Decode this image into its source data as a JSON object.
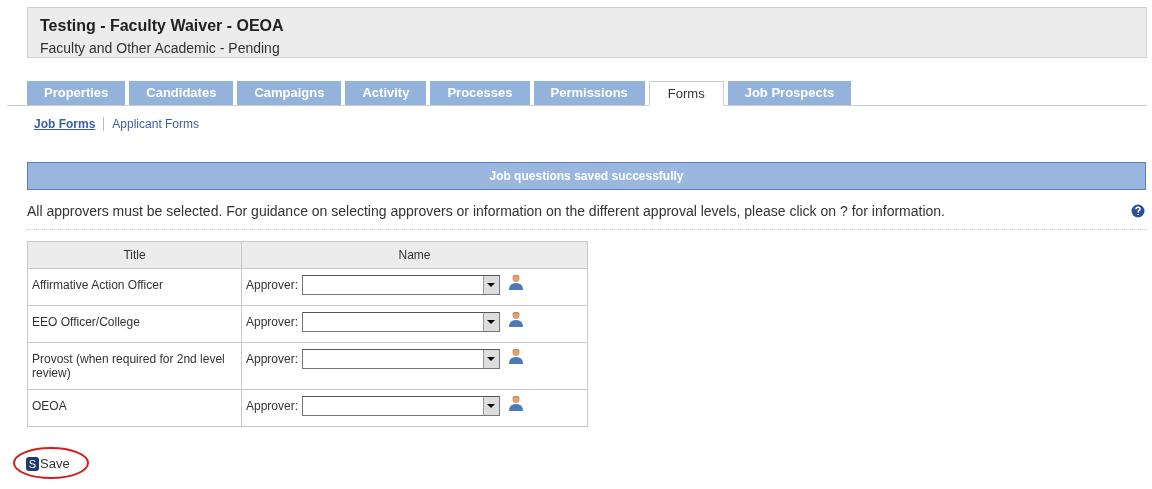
{
  "header": {
    "title": "Testing - Faculty Waiver - OEOA",
    "subtitle": "Faculty and Other Academic - Pending"
  },
  "tabs": [
    {
      "label": "Properties",
      "selected": false
    },
    {
      "label": "Candidates",
      "selected": false
    },
    {
      "label": "Campaigns",
      "selected": false
    },
    {
      "label": "Activity",
      "selected": false
    },
    {
      "label": "Processes",
      "selected": false
    },
    {
      "label": "Permissions",
      "selected": false
    },
    {
      "label": "Forms",
      "selected": true
    },
    {
      "label": "Job Prospects",
      "selected": false
    }
  ],
  "subtabs": [
    {
      "label": "Job Forms",
      "selected": true
    },
    {
      "label": "Applicant Forms",
      "selected": false
    }
  ],
  "banner": "Job questions saved successfully",
  "instructions": "All approvers must be selected. For guidance on selecting approvers or information on the different approval levels, please click on ? for information.",
  "table": {
    "columns": [
      "Title",
      "Name"
    ],
    "rows": [
      {
        "title": "Affirmative Action Officer",
        "label": "Approver:"
      },
      {
        "title": "EEO Officer/College",
        "label": "Approver:"
      },
      {
        "title": "Provost (when required for 2nd level review)",
        "label": "Approver:"
      },
      {
        "title": "OEOA",
        "label": "Approver:"
      }
    ]
  },
  "save": {
    "key": "S",
    "label": "Save",
    "highlighted": true
  }
}
